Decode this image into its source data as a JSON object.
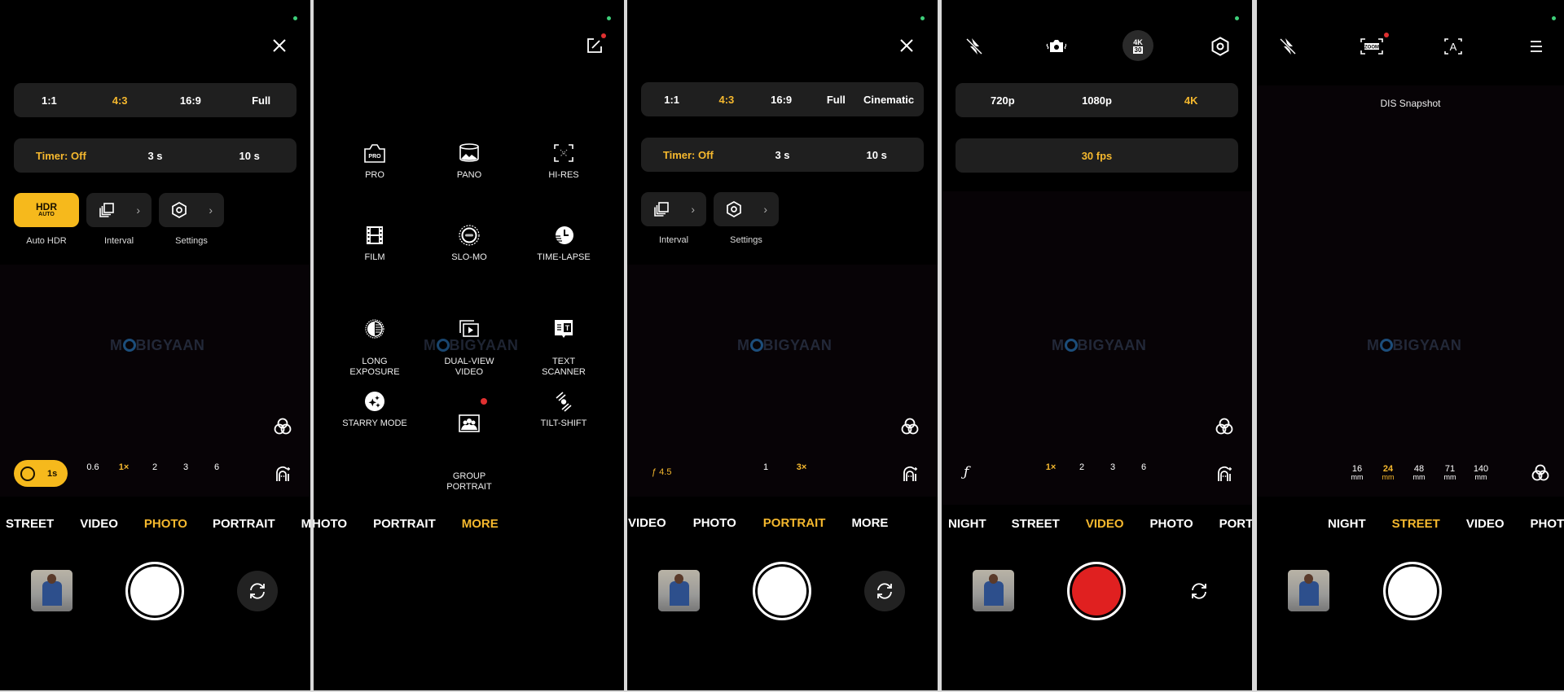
{
  "colors": {
    "accent": "#f5b82e",
    "record": "#e02020",
    "panel_bg": "#000000",
    "chip_bg": "#1f1f1f",
    "status_dot": "#3ecf7a",
    "badge": "#e03030"
  },
  "watermark": {
    "prefix": "M",
    "suffix": "BIGYAAN"
  },
  "panel1": {
    "aspect_ratios": [
      "1:1",
      "4:3",
      "16:9",
      "Full"
    ],
    "aspect_selected": "4:3",
    "timer_options": [
      "Timer: Off",
      "3 s",
      "10 s"
    ],
    "timer_selected": "Timer: Off",
    "hdr_badge": {
      "top": "HDR",
      "bottom": "AUTO"
    },
    "tiles": [
      {
        "label": "Auto HDR",
        "icon": "hdr-auto-icon"
      },
      {
        "label": "Interval",
        "icon": "interval-icon"
      },
      {
        "label": "Settings",
        "icon": "settings-hex-icon"
      }
    ],
    "night_pill": "1s",
    "zoom_levels": [
      "0.6",
      "1×",
      "2",
      "3",
      "6"
    ],
    "zoom_selected": "1×",
    "modes": [
      "STREET",
      "VIDEO",
      "PHOTO",
      "PORTRAIT",
      "MOR"
    ],
    "mode_selected": "PHOTO"
  },
  "panel2": {
    "more_modes": [
      {
        "label": "PRO",
        "icon": "pro-icon"
      },
      {
        "label": "PANO",
        "icon": "pano-icon"
      },
      {
        "label": "HI-RES",
        "icon": "hi-res-icon"
      },
      {
        "label": "FILM",
        "icon": "film-icon"
      },
      {
        "label": "SLO-MO",
        "icon": "slo-mo-icon"
      },
      {
        "label": "TIME-LAPSE",
        "icon": "time-lapse-icon"
      },
      {
        "label": "LONG\nEXPOSURE",
        "icon": "long-exposure-icon"
      },
      {
        "label": "DUAL-VIEW\nVIDEO",
        "icon": "dual-view-icon"
      },
      {
        "label": "TEXT\nSCANNER",
        "icon": "text-scanner-icon"
      },
      {
        "label": "STARRY MODE",
        "icon": "starry-icon"
      },
      {
        "label": "GROUP\nPORTRAIT",
        "icon": "group-portrait-icon",
        "badge": true
      },
      {
        "label": "TILT-SHIFT",
        "icon": "tilt-shift-icon"
      }
    ],
    "modes": [
      "HOTO",
      "PORTRAIT",
      "MORE"
    ],
    "mode_selected": "MORE"
  },
  "panel3": {
    "aspect_ratios": [
      "1:1",
      "4:3",
      "16:9",
      "Full",
      "Cinematic"
    ],
    "aspect_selected": "4:3",
    "timer_options": [
      "Timer: Off",
      "3 s",
      "10 s"
    ],
    "timer_selected": "Timer: Off",
    "tiles": [
      {
        "label": "Interval"
      },
      {
        "label": "Settings"
      }
    ],
    "aperture": "ƒ 4.5",
    "zoom_levels": [
      "1",
      "3×"
    ],
    "zoom_selected": "3×",
    "modes": [
      "VIDEO",
      "PHOTO",
      "PORTRAIT",
      "MORE"
    ],
    "mode_selected": "PORTRAIT"
  },
  "panel4": {
    "top_icons": [
      "flash-off-icon",
      "stabilization-icon",
      "resolution-4k30-icon",
      "settings-hex-icon"
    ],
    "res_badge": {
      "top": "4K",
      "bottom": "30"
    },
    "resolutions": [
      "720p",
      "1080p",
      "4K"
    ],
    "resolution_selected": "4K",
    "fps": "30 fps",
    "aperture_icon": "ƒ",
    "zoom_levels": [
      "1×",
      "2",
      "3",
      "6"
    ],
    "zoom_selected": "1×",
    "modes": [
      "NIGHT",
      "STREET",
      "VIDEO",
      "PHOTO",
      "PORTRA"
    ],
    "mode_selected": "VIDEO"
  },
  "panel5": {
    "top_icons": [
      "flash-off-icon",
      "zoom-frame-icon",
      "auto-text-icon",
      "menu-icon"
    ],
    "zoom_badge_label": "ZOOM",
    "toast": "DIS Snapshot",
    "focal_lengths": [
      {
        "value": "16",
        "unit": "mm"
      },
      {
        "value": "24",
        "unit": "mm"
      },
      {
        "value": "48",
        "unit": "mm"
      },
      {
        "value": "71",
        "unit": "mm"
      },
      {
        "value": "140",
        "unit": "mm"
      }
    ],
    "focal_selected": "24",
    "modes": [
      "NIGHT",
      "STREET",
      "VIDEO",
      "PHOTO"
    ],
    "mode_selected": "STREET"
  }
}
